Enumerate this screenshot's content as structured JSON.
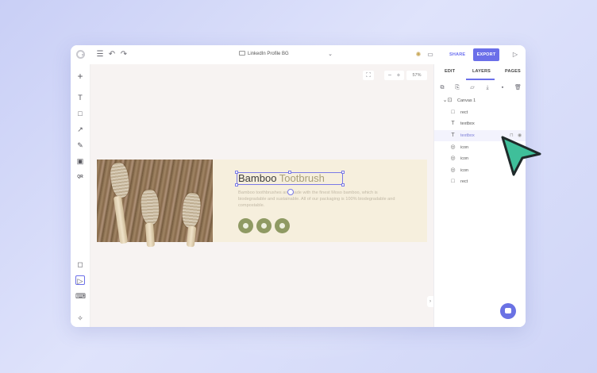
{
  "header": {
    "doc_title": "LinkedIn Profile BG",
    "share_label": "SHARE",
    "export_label": "EXPORT",
    "zoom": "57%"
  },
  "banner": {
    "headline_main": "Bamboo ",
    "headline_accent": "Tootbrush",
    "body": "Bamboo toothbrushes are made with the finest Moso bamboo, which is biodegradable and sustainable. All of our packaging is 100% biodegradable and compostable."
  },
  "panel": {
    "tabs": [
      "EDIT",
      "LAYERS",
      "PAGES"
    ],
    "active_tab": "LAYERS",
    "layers": [
      {
        "name": "Canvas 1",
        "icon": "frame-icon"
      },
      {
        "name": "rect",
        "icon": "rect-icon"
      },
      {
        "name": "textbox",
        "icon": "text-icon"
      },
      {
        "name": "textbox",
        "icon": "text-icon",
        "selected": true
      },
      {
        "name": "icon",
        "icon": "icon-icon"
      },
      {
        "name": "icon",
        "icon": "icon-icon"
      },
      {
        "name": "icon",
        "icon": "icon-icon"
      },
      {
        "name": "rect",
        "icon": "rect-icon"
      }
    ]
  },
  "colors": {
    "accent": "#6b6fe9",
    "cursor": "#3fbf9a",
    "banner_bg": "#f6efdd",
    "icon_green": "#8f9a63"
  }
}
